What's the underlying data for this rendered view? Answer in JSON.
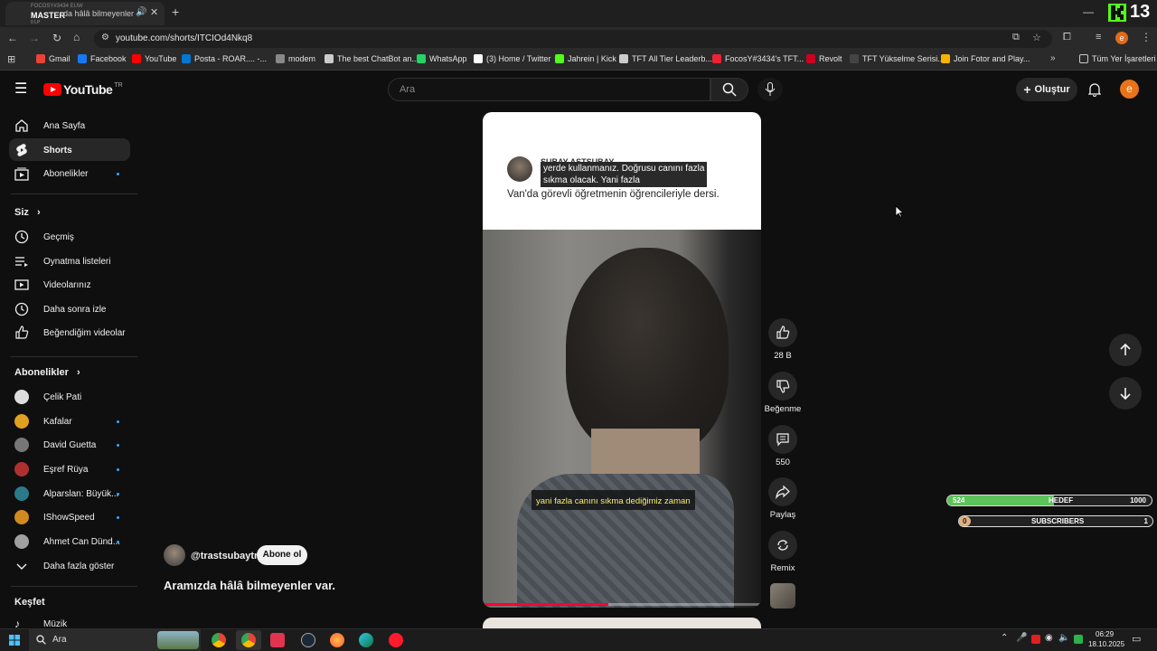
{
  "browser": {
    "tab_channel": "MASTER",
    "tab_sub": "0 LP",
    "tab_overlay": "FOCOSY#3434 EUW",
    "tab_title": "da hâlâ bilmeyenler",
    "url": "youtube.com/shorts/ITCIOd4Nkq8",
    "profile_letter": "e",
    "kick_number": "13"
  },
  "bookmarks": [
    {
      "label": "Gmail",
      "color": "#ea4335"
    },
    {
      "label": "Facebook",
      "color": "#1877f2"
    },
    {
      "label": "YouTube",
      "color": "#ff0000"
    },
    {
      "label": "Posta - ROAR.... -...",
      "color": "#0078d4"
    },
    {
      "label": "modem",
      "color": "#888888"
    },
    {
      "label": "The best ChatBot an...",
      "color": "#cccccc"
    },
    {
      "label": "WhatsApp",
      "color": "#25d366"
    },
    {
      "label": "(3) Home / Twitter",
      "color": "#ffffff"
    },
    {
      "label": "Jahrein | Kick",
      "color": "#53fc18"
    },
    {
      "label": "TFT All Tier Leaderb...",
      "color": "#cccccc"
    },
    {
      "label": "FocosY#3434's TFT...",
      "color": "#e23"
    },
    {
      "label": "Revolt",
      "color": "#c02"
    },
    {
      "label": "TFT Yükselme Serisi...",
      "color": "#444"
    },
    {
      "label": "Join Fotor and Play...",
      "color": "#f7b500"
    }
  ],
  "bookmarks_all": "Tüm Yer İşaretleri",
  "yt": {
    "logo": "YouTube",
    "country": "TR",
    "search_placeholder": "Ara",
    "create_label": "Oluştur",
    "user_letter": "e"
  },
  "sidebar": {
    "main": [
      {
        "label": "Ana Sayfa"
      },
      {
        "label": "Shorts"
      },
      {
        "label": "Abonelikler"
      }
    ],
    "you_header": "Siz",
    "you": [
      {
        "label": "Geçmiş"
      },
      {
        "label": "Oynatma listeleri"
      },
      {
        "label": "Videolarınız"
      },
      {
        "label": "Daha sonra izle"
      },
      {
        "label": "Beğendiğim videolar"
      }
    ],
    "subs_header": "Abonelikler",
    "subs": [
      {
        "label": "Çelik Pati",
        "color": "#dddddd"
      },
      {
        "label": "Kafalar",
        "color": "#e0a020"
      },
      {
        "label": "David Guetta",
        "color": "#777777"
      },
      {
        "label": "Eşref Rüya",
        "color": "#b03030"
      },
      {
        "label": "Alparslan: Büyük...",
        "color": "#2a7a8a"
      },
      {
        "label": "IShowSpeed",
        "color": "#d08a20"
      },
      {
        "label": "Ahmet Can Dünd...",
        "color": "#a0a0a0"
      }
    ],
    "show_more": "Daha fazla göster",
    "explore_header": "Keşfet",
    "music": "Müzik"
  },
  "short": {
    "tweet_name": "SUBAY ASTSUBAY",
    "tweet_caption_1": "yerde kullanmanız. Doğrusu canını fazla",
    "tweet_caption_2": "sıkma olacak. Yani fazla",
    "tweet_text": "Van'da görevli öğretmenin öğrencileriyle dersi.",
    "subtitle": "yani fazla canını sıkma dediğimiz zaman",
    "channel": "@trastsubaytr",
    "subscribe": "Abone ol",
    "title": "Aramızda hâlâ bilmeyenler var.",
    "progress": 0.45
  },
  "actions": {
    "likes": "28 B",
    "dislike": "Beğenme",
    "comments": "550",
    "share": "Paylaş",
    "remix": "Remix"
  },
  "overlay": {
    "goal_left": "524",
    "goal_label": "HEDEF",
    "goal_right": "1000",
    "goal_fraction": 0.52,
    "subs_left": "0",
    "subs_label": "SUBSCRIBERS",
    "subs_right": "1"
  },
  "taskbar": {
    "search": "Ara",
    "time": "06:29",
    "date": "18.10.2025"
  }
}
